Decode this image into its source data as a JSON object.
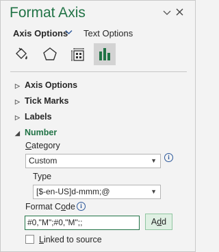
{
  "panel": {
    "title": "Format Axis",
    "dropdown_icon": "chevron-down-icon",
    "close_icon": "close-icon"
  },
  "tabs": {
    "axis_options": "Axis Options",
    "text_options": "Text Options"
  },
  "icons": [
    "fill-line-icon",
    "effects-pentagon-icon",
    "size-properties-icon",
    "axis-options-bar-chart-icon"
  ],
  "sections": {
    "axis_options": "Axis Options",
    "tick_marks": "Tick Marks",
    "labels": "Labels",
    "number": "Number"
  },
  "number": {
    "category_label_u": "C",
    "category_label_rest": "ategory",
    "category_value": "Custom",
    "type_label": "Type",
    "type_value": "[$-en-US]d-mmm;@",
    "format_code_label_pre": "Format C",
    "format_code_label_u": "o",
    "format_code_label_post": "de",
    "format_code_value": "#0,\"M\";#0,\"M\";;",
    "add_label_pre": "A",
    "add_label_u": "d",
    "add_label_post": "d",
    "linked_label_u": "L",
    "linked_label_rest": "inked to source",
    "linked_checked": false
  },
  "colors": {
    "accent_green": "#217346",
    "accent_blue": "#2b579a",
    "background": "#f3f3f3"
  }
}
